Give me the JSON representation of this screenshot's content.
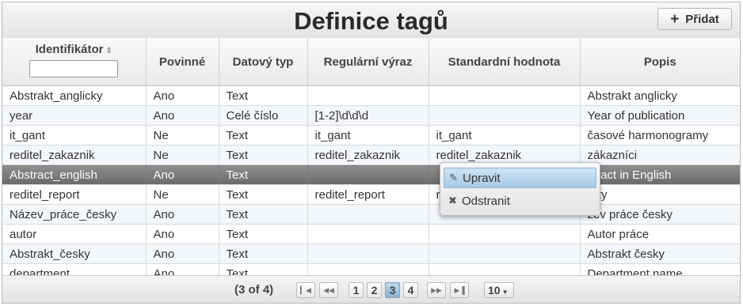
{
  "header": {
    "title": "Definice tagů",
    "add_label": "Přidat"
  },
  "table": {
    "columns": [
      "Identifikátor",
      "Povinné",
      "Datový typ",
      "Regulární výraz",
      "Standardní hodnota",
      "Popis"
    ],
    "rows": [
      [
        "Abstrakt_anglicky",
        "Ano",
        "Text",
        "",
        "",
        "Abstrakt anglicky"
      ],
      [
        "year",
        "Ano",
        "Celé číslo",
        "[1-2]\\d\\d\\d",
        "",
        "Year of publication"
      ],
      [
        "it_gant",
        "Ne",
        "Text",
        "it_gant",
        "it_gant",
        "časové harmonogramy"
      ],
      [
        "reditel_zakaznik",
        "Ne",
        "Text",
        "reditel_zakaznik",
        "reditel_zakaznik",
        "zákazníci"
      ],
      [
        "Abstract_english",
        "Ano",
        "Text",
        "",
        "",
        "stract in English"
      ],
      [
        "reditel_report",
        "Ne",
        "Text",
        "reditel_report",
        "r",
        "orty"
      ],
      [
        "Název_práce_česky",
        "Ano",
        "Text",
        "",
        "",
        "zev práce česky"
      ],
      [
        "autor",
        "Ano",
        "Text",
        "",
        "",
        "Autor práce"
      ],
      [
        "Abstrakt_česky",
        "Ano",
        "Text",
        "",
        "",
        "Abstrakt česky"
      ],
      [
        "department",
        "Ano",
        "Text",
        "",
        "",
        "Department name"
      ]
    ]
  },
  "context_menu": {
    "edit_label": "Upravit",
    "delete_label": "Odstranit"
  },
  "paginator": {
    "info": "(3 of 4)",
    "pages": [
      "1",
      "2",
      "3",
      "4"
    ],
    "current_page": "3",
    "rows_per_page": "10"
  }
}
